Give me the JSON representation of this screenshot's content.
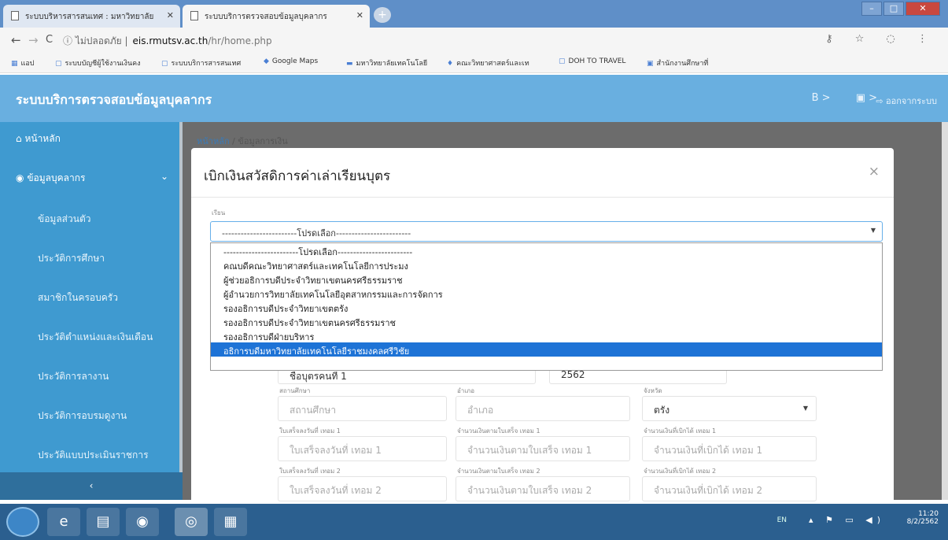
{
  "browser": {
    "tabs": [
      {
        "label": "ระบบบริหารสารสนเทศ : มหาวิทยาลัย"
      },
      {
        "label": "ระบบบริการตรวจสอบข้อมูลบุคลากร"
      }
    ],
    "new_tab": "+",
    "window_buttons": {
      "min": "–",
      "max": "□",
      "close": "✕"
    },
    "address": {
      "lock": "ⓘ ไม่ปลอดภัย |",
      "host": "eis.rmutsv.ac.th",
      "path": "/hr/home.php"
    },
    "nav": {
      "back": "←",
      "forward": "→",
      "reload": "C"
    },
    "addr_icons": "⚷ ☆ ◌ ⋮",
    "bookmarks": [
      {
        "label": "แอป",
        "icon": "▦"
      },
      {
        "label": "ระบบบัญชีผู้ใช้งานเงินคง",
        "icon": "▢"
      },
      {
        "label": "ระบบบริการสารสนเทศ",
        "icon": "▢"
      },
      {
        "label": "Google Maps",
        "icon": "◆"
      },
      {
        "label": "มหาวิทยาลัยเทคโนโลยี",
        "icon": "▬"
      },
      {
        "label": "คณะวิทยาศาสตร์และเท",
        "icon": "♦"
      },
      {
        "label": "DOH TO TRAVEL",
        "icon": "▢"
      },
      {
        "label": "สำนักงานศึกษาที่",
        "icon": "▣"
      }
    ]
  },
  "app": {
    "title": "ระบบบริการตรวจสอบข้อมูลบุคลากร",
    "header_icons": [
      "B >",
      "▣ >"
    ],
    "logout": "⇨ ออกจากระบบ"
  },
  "sidebar": {
    "items": [
      {
        "label": "หน้าหลัก",
        "icon": "⌂"
      },
      {
        "label": "ข้อมูลบุคลากร",
        "icon": "◉",
        "chevron": "⌄"
      }
    ],
    "sub_items": [
      {
        "label": "ข้อมูลส่วนตัว"
      },
      {
        "label": "ประวัติการศึกษา"
      },
      {
        "label": "สมาชิกในครอบครัว"
      },
      {
        "label": "ประวัติตำแหน่งและเงินเดือน"
      },
      {
        "label": "ประวัติการลางาน"
      },
      {
        "label": "ประวัติการอบรมดูงาน"
      },
      {
        "label": "ประวัติแบบประเมินราชการ"
      }
    ],
    "collapse": "‹"
  },
  "breadcrumb": {
    "home": "หน้าหลัก",
    "current": "/ ข้อมูลการเงิน"
  },
  "modal": {
    "title": "เบิกเงินสวัสดิการค่าเล่าเรียนบุตร",
    "close": "×",
    "field_label": "เรียน",
    "selected": "------------------------โปรดเลือก------------------------",
    "options": [
      "------------------------โปรดเลือก------------------------",
      "คณบดีคณะวิทยาศาสตร์และเทคโนโลยีการประมง",
      "ผู้ช่วยอธิการบดีประจำวิทยาเขตนครศรีธรรมราช",
      "ผู้อำนวยการวิทยาลัยเทคโนโลยีอุตสาหกรรมและการจัดการ",
      "รองอธิการบดีประจำวิทยาเขตตรัง",
      "รองอธิการบดีประจำวิทยาเขตนครศรีธรรมราช",
      "รองอธิการบดีฝ่ายบริหาร",
      "อธิการบดีมหาวิทยาลัยเทคโนโลยีราชมงคลศรีวิชัย"
    ],
    "selected_option_index": 7,
    "hidden_row": {
      "left": "ชื่อบุตรคนที่ 1",
      "middle": "2562"
    },
    "fields": {
      "school_label": "สถานศึกษา",
      "school_placeholder": "สถานศึกษา",
      "district_label": "อำเภอ",
      "district_placeholder": "อำเภอ",
      "province_label": "จังหวัด",
      "province_value": "ตรัง",
      "receipt1_label": "ใบเสร็จลงวันที่ เทอม 1",
      "receipt1_placeholder": "ใบเสร็จลงวันที่ เทอม 1",
      "amount1_label": "จำนวนเงินตามใบเสร็จ เทอม 1",
      "amount1_placeholder": "จำนวนเงินตามใบเสร็จ เทอม 1",
      "claim1_label": "จำนวนเงินที่เบิกได้ เทอม 1",
      "claim1_placeholder": "จำนวนเงินที่เบิกได้ เทอม 1",
      "receipt2_label": "ใบเสร็จลงวันที่ เทอม 2",
      "receipt2_placeholder": "ใบเสร็จลงวันที่ เทอม 2",
      "amount2_label": "จำนวนเงินตามใบเสร็จ เทอม 2",
      "amount2_placeholder": "จำนวนเงินตามใบเสร็จ เทอม 2",
      "claim2_label": "จำนวนเงินที่เบิกได้ เทอม 2",
      "claim2_placeholder": "จำนวนเงินที่เบิกได้ เทอม 2"
    }
  },
  "taskbar": {
    "apps": [
      "e",
      "▤",
      "◉",
      "◎",
      "▦"
    ],
    "lang": "EN",
    "tray_icons": "▴ ⚑ ▭ ◀)",
    "time": "11:20",
    "date": "8/2/2562"
  }
}
